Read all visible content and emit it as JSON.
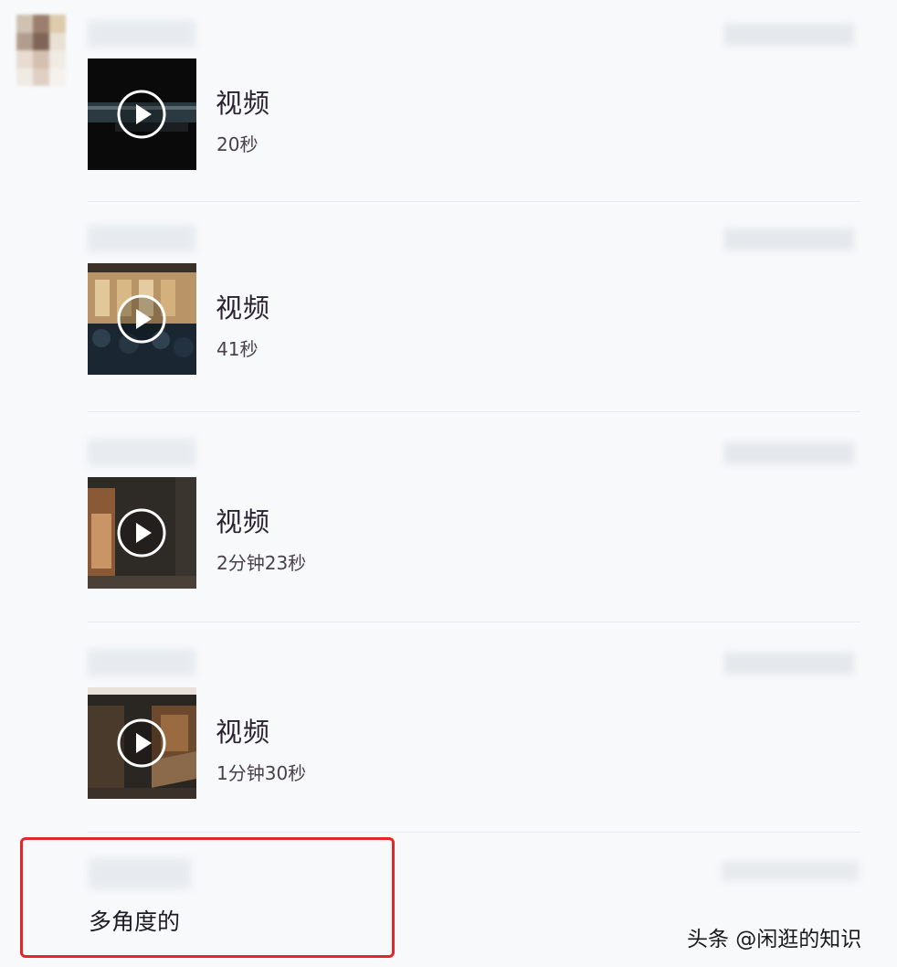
{
  "messages": [
    {
      "label": "视频",
      "duration": "20秒"
    },
    {
      "label": "视频",
      "duration": "41秒"
    },
    {
      "label": "视频",
      "duration": "2分钟23秒"
    },
    {
      "label": "视频",
      "duration": "1分钟30秒"
    }
  ],
  "last_message": {
    "text": "多角度的"
  },
  "watermark": "头条 @闲逛的知识",
  "colors": {
    "highlight_border": "#e3262b",
    "background": "#f7f9fb"
  }
}
